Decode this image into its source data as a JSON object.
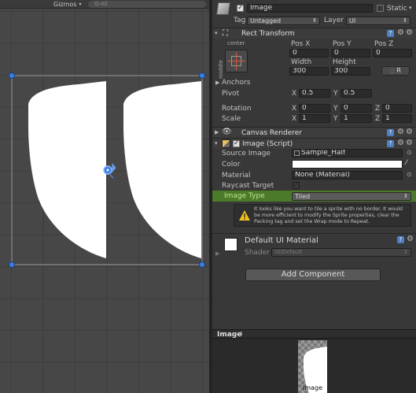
{
  "scene": {
    "gizmos_label": "Gizmos",
    "search_placeholder": "Q-All"
  },
  "header": {
    "object_name": "Image",
    "static_label": "Static",
    "tag_label": "Tag",
    "tag_value": "Untagged",
    "layer_label": "Layer",
    "layer_value": "UI"
  },
  "rect_transform": {
    "title": "Rect Transform",
    "anchor_h": "center",
    "anchor_v": "middle",
    "pos_x_label": "Pos X",
    "pos_y_label": "Pos Y",
    "pos_z_label": "Pos Z",
    "pos_x": "0",
    "pos_y": "0",
    "pos_z": "0",
    "width_label": "Width",
    "height_label": "Height",
    "width": "300",
    "height": "300",
    "r_label": "R",
    "anchors_label": "Anchors",
    "pivot_label": "Pivot",
    "pivot_x_label": "X",
    "pivot_x": "0.5",
    "pivot_y_label": "Y",
    "pivot_y": "0.5",
    "rotation_label": "Rotation",
    "rot_x_label": "X",
    "rot_x": "0",
    "rot_y_label": "Y",
    "rot_y": "0",
    "rot_z_label": "Z",
    "rot_z": "0",
    "scale_label": "Scale",
    "scale_x_label": "X",
    "scale_x": "1",
    "scale_y_label": "Y",
    "scale_y": "1",
    "scale_z_label": "Z",
    "scale_z": "1"
  },
  "canvas_renderer": {
    "title": "Canvas Renderer"
  },
  "image_script": {
    "title": "Image (Script)",
    "source_image_label": "Source Image",
    "source_image_value": "Sample_Half",
    "color_label": "Color",
    "material_label": "Material",
    "material_value": "None (Material)",
    "raycast_label": "Raycast Target",
    "image_type_label": "Image Type",
    "image_type_value": "Tiled",
    "warning": "It looks like you want to tile a sprite with no border. It would be more efficient to modify the Sprite properties, clear the Packing tag and set the Wrap mode to Repeat."
  },
  "material": {
    "title": "Default UI Material",
    "shader_label": "Shader",
    "shader_value": "UI/Default"
  },
  "add_component_label": "Add Component",
  "preview": {
    "title": "Image",
    "thumb_label": "Image"
  },
  "colors": {
    "highlight_row": "#4a7a2a",
    "image_type_text": "#7fbf3f",
    "selection_handle": "#3a7fe0"
  }
}
